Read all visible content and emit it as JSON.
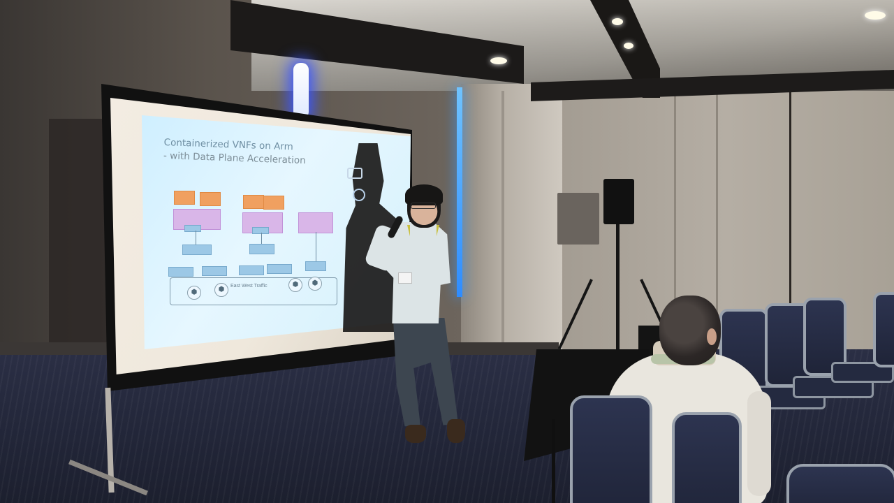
{
  "slide": {
    "title_line1": "Containerized VNFs on Arm",
    "title_line2": "- with Data Plane Acceleration",
    "rail_label": "East West Traffic"
  },
  "palette": {
    "projection": "#d4f0fb",
    "vnf_box": "#f0a060",
    "container_box": "#d9b6e8",
    "net_box": "#9cc8e6",
    "floor": "#23273a",
    "chair": "#2d3450",
    "accent_light": "#3a9cff"
  },
  "icons": [
    "arm-logo-icon",
    "speaker-icon",
    "microphone-icon"
  ]
}
